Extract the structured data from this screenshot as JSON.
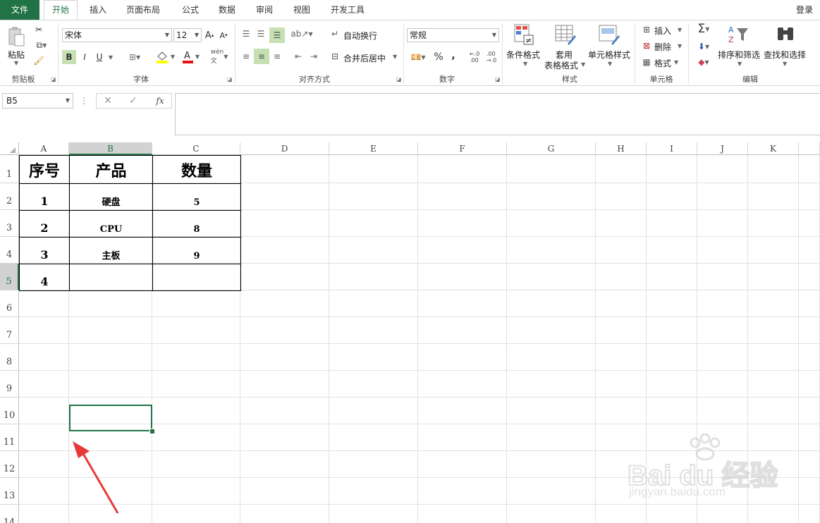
{
  "tabs": {
    "file": "文件",
    "home": "开始",
    "insert": "插入",
    "page_layout": "页面布局",
    "formulas": "公式",
    "data": "数据",
    "review": "审阅",
    "view": "视图",
    "developer": "开发工具",
    "login": "登录"
  },
  "ribbon": {
    "clipboard": {
      "paste": "粘贴",
      "label": "剪贴板"
    },
    "font": {
      "name": "宋体",
      "size": "12",
      "bold": "B",
      "italic": "I",
      "underline": "U",
      "label": "字体"
    },
    "align": {
      "wrap": "自动换行",
      "merge": "合并后居中",
      "label": "对齐方式"
    },
    "number": {
      "format": "常规",
      "percent": "%",
      "comma": ",",
      "label": "数字"
    },
    "styles": {
      "cond": "条件格式",
      "table1": "套用",
      "table2": "表格格式",
      "cell_style": "单元格样式",
      "label": "样式"
    },
    "cells": {
      "insert": "插入",
      "delete": "删除",
      "format": "格式",
      "label": "单元格"
    },
    "editing": {
      "sort": "排序和筛选",
      "find": "查找和选择",
      "label": "编辑"
    }
  },
  "formula_bar": {
    "name_box": "B5",
    "fx": "fx",
    "value": ""
  },
  "columns": [
    "A",
    "B",
    "C",
    "D",
    "E",
    "F",
    "G",
    "H",
    "I",
    "J",
    "K"
  ],
  "rows": [
    "1",
    "2",
    "3",
    "4",
    "5",
    "6",
    "7",
    "8",
    "9",
    "10",
    "11",
    "12",
    "13",
    "14"
  ],
  "selected_cell": "B5",
  "table": {
    "header": [
      "序号",
      "产品",
      "数量"
    ],
    "rows": [
      [
        "1",
        "硬盘",
        "5"
      ],
      [
        "2",
        "CPU",
        "8"
      ],
      [
        "3",
        "主板",
        "9"
      ],
      [
        "4",
        "",
        ""
      ]
    ]
  },
  "watermark": {
    "brand": "Bai du 经验",
    "url": "jingyan.baidu.com"
  },
  "colors": {
    "accent": "#217346",
    "arrow": "#e8393a",
    "selection": "#c6e0b4"
  }
}
